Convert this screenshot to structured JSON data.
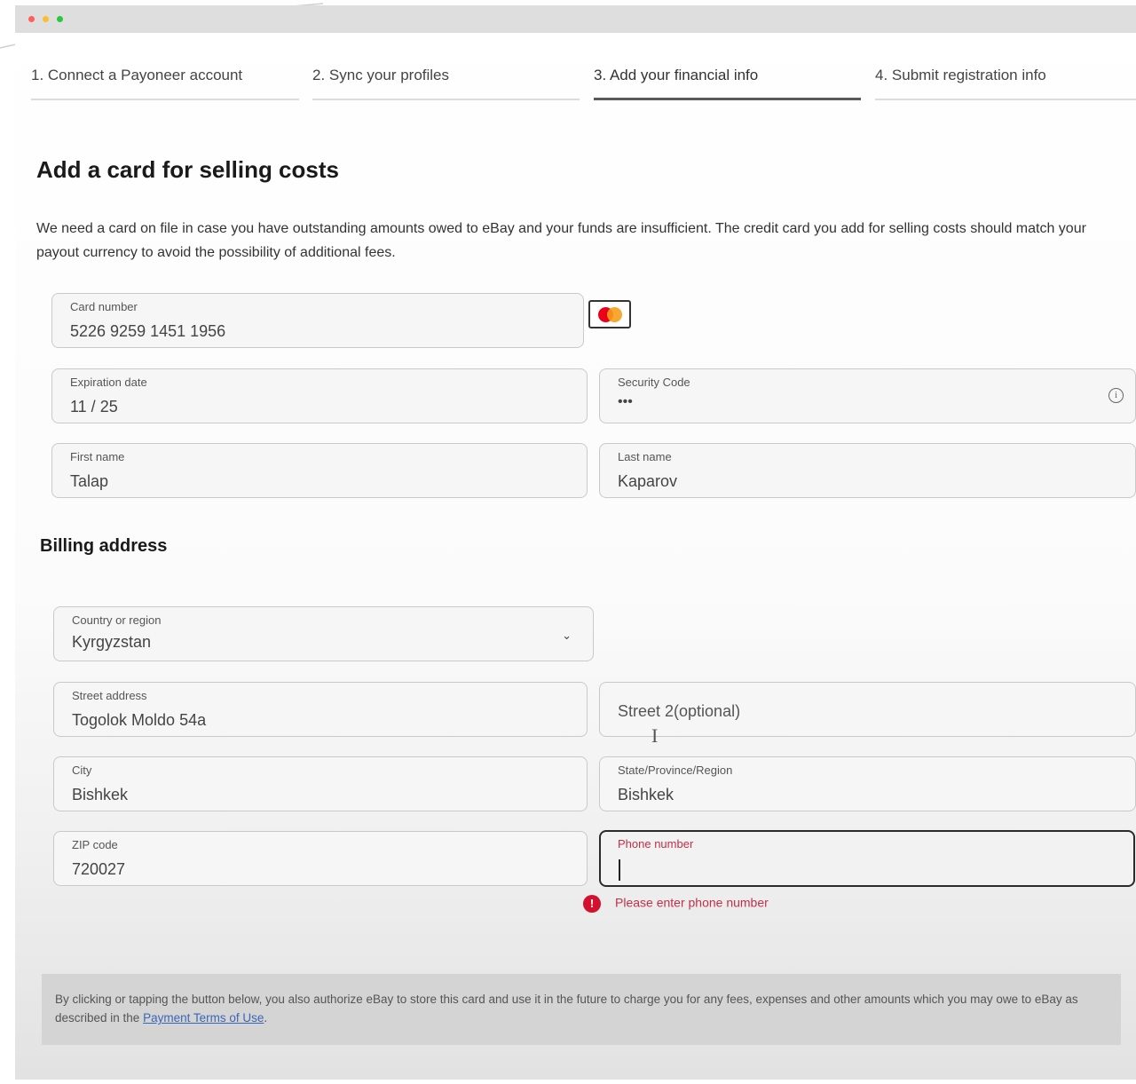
{
  "steps": [
    {
      "label": "1. Connect a Payoneer account",
      "active": false
    },
    {
      "label": "2. Sync your profiles",
      "active": false
    },
    {
      "label": "3. Add your financial info",
      "active": true
    },
    {
      "label": "4. Submit registration info",
      "active": false
    }
  ],
  "form": {
    "title": "Add a card for selling costs",
    "description": "We need a card on file in case you have outstanding amounts owed to eBay and your funds are insufficient. The credit card you add for selling costs should match your payout currency to avoid the possibility of additional fees.",
    "card_number": {
      "label": "Card number",
      "value": "5226 9259 1451 1956"
    },
    "card_brand": "mastercard-icon",
    "expiration": {
      "label": "Expiration date",
      "value": "11 / 25"
    },
    "security_code": {
      "label": "Security Code",
      "value": "•••"
    },
    "first_name": {
      "label": "First name",
      "value": "Talap"
    },
    "last_name": {
      "label": "Last name",
      "value": "Kaparov"
    }
  },
  "billing": {
    "title": "Billing address",
    "country": {
      "label": "Country or region",
      "value": "Kyrgyzstan"
    },
    "street": {
      "label": "Street address",
      "value": "Togolok Moldo 54a"
    },
    "street2": {
      "placeholder": "Street 2(optional)"
    },
    "city": {
      "label": "City",
      "value": "Bishkek"
    },
    "state": {
      "label": "State/Province/Region",
      "value": "Bishkek"
    },
    "zip": {
      "label": "ZIP code",
      "value": "720027"
    },
    "phone": {
      "label": "Phone number",
      "value": "",
      "error": "Please enter phone number"
    }
  },
  "notice": {
    "text": "By clicking or tapping the button below, you also authorize eBay to store this card and use it in the future to charge you for any fees, expenses and other amounts which you may owe to eBay as described in the ",
    "link": "Payment Terms of Use",
    "end": "."
  },
  "colors": {
    "error": "#c0304a",
    "error_icon": "#d1112d",
    "active_step": "#5a5a5a"
  }
}
